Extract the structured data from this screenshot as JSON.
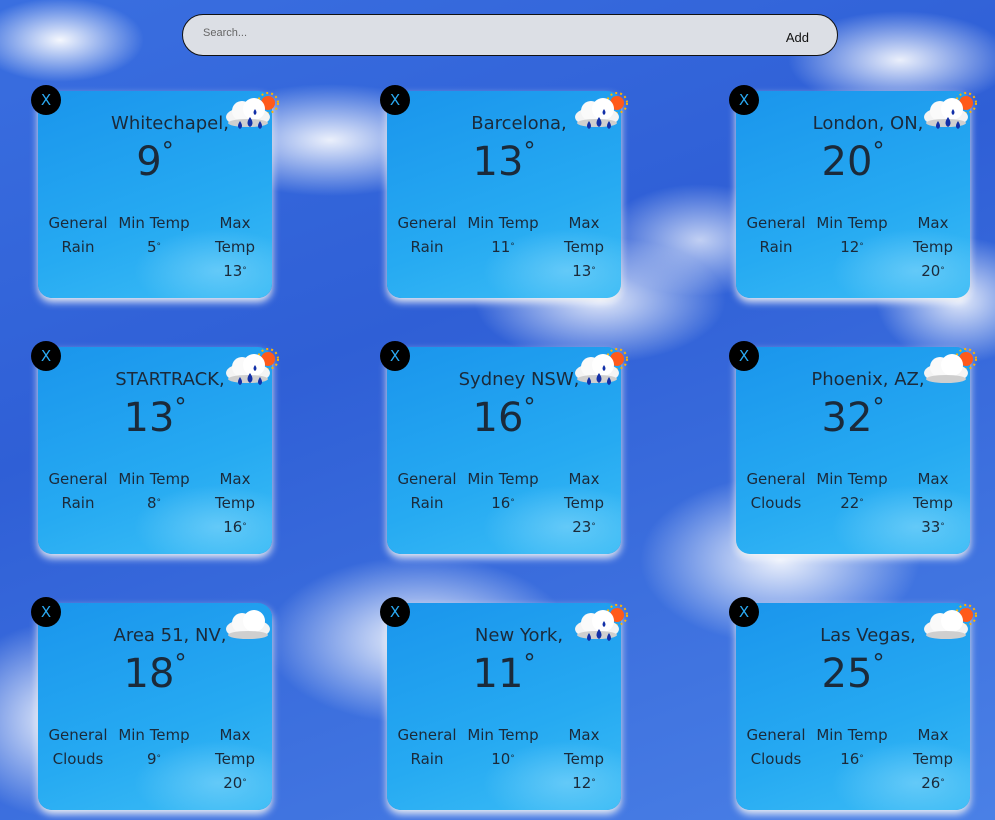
{
  "search": {
    "placeholder": "Search...",
    "add_label": "Add"
  },
  "labels": {
    "close": "X",
    "general": "General",
    "min_temp": "Min Temp",
    "max": "Max",
    "temp": "Temp",
    "degree": "°"
  },
  "cards": [
    {
      "city": "Whitechapel,",
      "temp": "9",
      "general": "Rain",
      "min": "5",
      "max": "13",
      "icon": "rain-sun-icon"
    },
    {
      "city": "Barcelona,",
      "temp": "13",
      "general": "Rain",
      "min": "11",
      "max": "13",
      "icon": "rain-sun-icon"
    },
    {
      "city": "London, ON,",
      "temp": "20",
      "general": "Rain",
      "min": "12",
      "max": "20",
      "icon": "rain-sun-icon"
    },
    {
      "city": "STARTRACK,",
      "temp": "13",
      "general": "Rain",
      "min": "8",
      "max": "16",
      "icon": "rain-sun-icon"
    },
    {
      "city": "Sydney NSW,",
      "temp": "16",
      "general": "Rain",
      "min": "16",
      "max": "23",
      "icon": "rain-sun-icon"
    },
    {
      "city": "Phoenix, AZ,",
      "temp": "32",
      "general": "Clouds",
      "min": "22",
      "max": "33",
      "icon": "cloud-sun-icon"
    },
    {
      "city": "Area 51, NV,",
      "temp": "18",
      "general": "Clouds",
      "min": "9",
      "max": "20",
      "icon": "cloud-icon"
    },
    {
      "city": "New York,",
      "temp": "11",
      "general": "Rain",
      "min": "10",
      "max": "12",
      "icon": "rain-sun-icon"
    },
    {
      "city": "Las Vegas,",
      "temp": "25",
      "general": "Clouds",
      "min": "16",
      "max": "26",
      "icon": "cloud-sun-icon"
    }
  ]
}
